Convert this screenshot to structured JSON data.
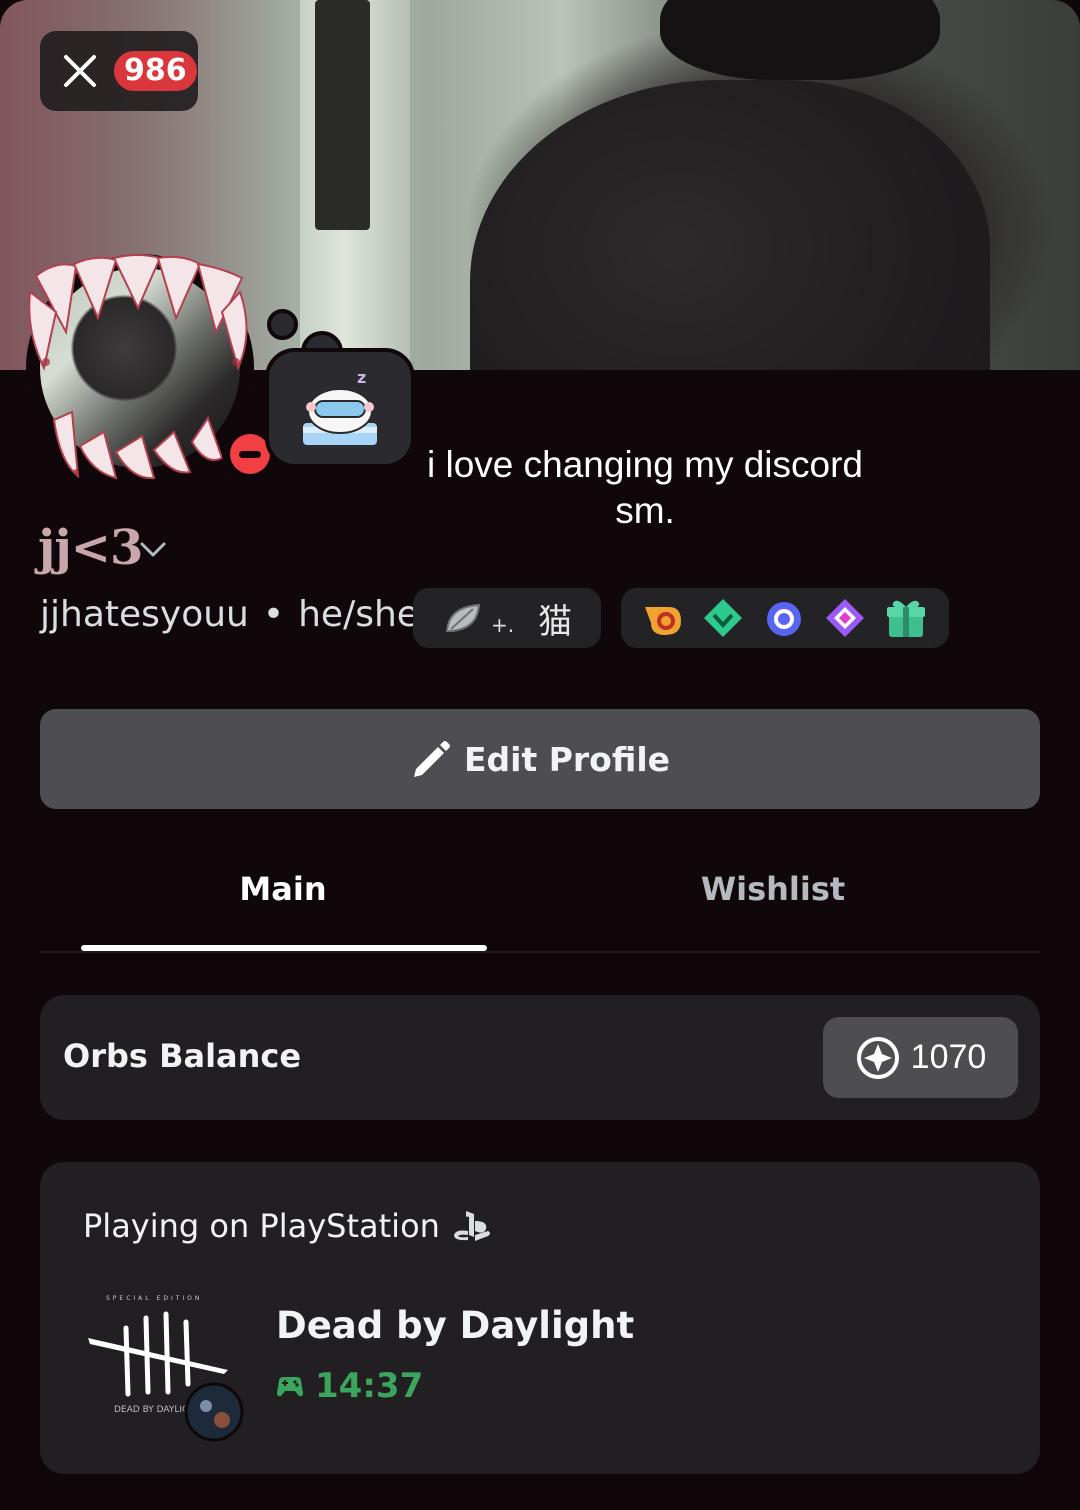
{
  "header": {
    "notification_count": "986"
  },
  "profile": {
    "custom_status": "i love changing my discord sm.",
    "status_emoji": "sleeping-sheep-emoji",
    "display_name": "jj<3",
    "username": "jjhatesyouu",
    "separator": "•",
    "pronouns": "he/she",
    "tag_text": "猫",
    "tag_dots": "+.",
    "status": "do-not-disturb"
  },
  "badges": [
    "hypesquad-balance-badge",
    "nitro-emerald-badge",
    "quest-laurel-badge",
    "boost-diamond-badge",
    "gift-badge"
  ],
  "actions": {
    "edit_profile_label": "Edit Profile"
  },
  "tabs": [
    {
      "label": "Main",
      "active": true
    },
    {
      "label": "Wishlist",
      "active": false
    }
  ],
  "orbs": {
    "label": "Orbs Balance",
    "value": "1070"
  },
  "activity": {
    "header": "Playing on PlayStation",
    "game_title": "Dead by Daylight",
    "elapsed": "14:37",
    "art_top_text": "SPECIAL EDITION",
    "art_caption": "DEAD BY DAYLIGHT"
  },
  "colors": {
    "background": "#0f0709",
    "card": "#221f22",
    "button": "#4e4d52",
    "dnd": "#f23f43",
    "badge_red": "#da373c",
    "elapsed_green": "#3ba55d"
  }
}
